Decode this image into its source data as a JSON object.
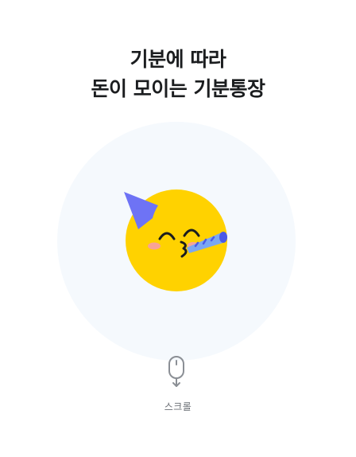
{
  "headline": {
    "line1": "기분에 따라",
    "line2": "돈이 모이는 기분통장"
  },
  "illustration": {
    "icon": "party-face-icon",
    "colors": {
      "face": "#FFD200",
      "hat": "#6E73F5",
      "blush": "#F8A397",
      "background_circle": "#F5F9FD"
    }
  },
  "scroll_hint": {
    "icon": "mouse-scroll-icon",
    "label": "스크롤"
  }
}
